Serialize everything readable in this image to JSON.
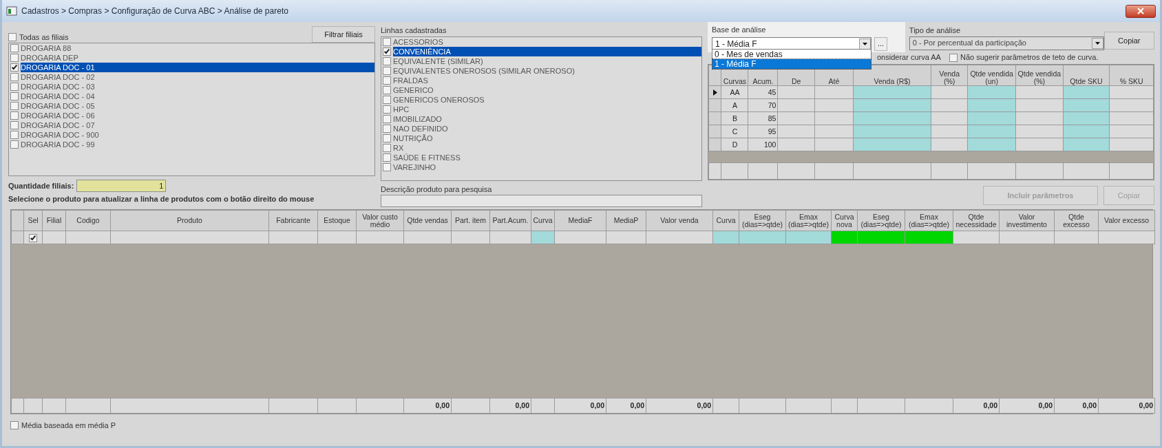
{
  "window": {
    "title": "Cadastros > Compras > Configuração de Curva ABC > Análise de pareto"
  },
  "branches": {
    "all": {
      "label": "Todas as filiais",
      "checked": false
    },
    "filter_button": "Filtrar filiais",
    "items": [
      {
        "label": "DROGARIA 88",
        "checked": false,
        "selected": false
      },
      {
        "label": "DROGARIA DEP",
        "checked": false,
        "selected": false
      },
      {
        "label": "DROGARIA DOC - 01",
        "checked": true,
        "selected": true
      },
      {
        "label": "DROGARIA DOC - 02",
        "checked": false,
        "selected": false
      },
      {
        "label": "DROGARIA DOC - 03",
        "checked": false,
        "selected": false
      },
      {
        "label": "DROGARIA DOC - 04",
        "checked": false,
        "selected": false
      },
      {
        "label": "DROGARIA DOC - 05",
        "checked": false,
        "selected": false
      },
      {
        "label": "DROGARIA DOC - 06",
        "checked": false,
        "selected": false
      },
      {
        "label": "DROGARIA DOC - 07",
        "checked": false,
        "selected": false
      },
      {
        "label": "DROGARIA DOC - 900",
        "checked": false,
        "selected": false
      },
      {
        "label": "DROGARIA DOC - 99",
        "checked": false,
        "selected": false
      }
    ]
  },
  "branch_count": {
    "label": "Quantidade filiais:",
    "value": "1"
  },
  "instruction": "Selecione o produto para atualizar a linha de produtos com o botão direito do mouse",
  "product_lines": {
    "label": "Linhas cadastradas",
    "items": [
      {
        "label": "ACESSORIOS",
        "checked": false,
        "selected": false
      },
      {
        "label": "CONVENIÊNCIA",
        "checked": true,
        "selected": true
      },
      {
        "label": "EQUIVALENTE (SIMILAR)",
        "checked": false,
        "selected": false
      },
      {
        "label": "EQUIVALENTES ONEROSOS (SIMILAR ONEROSO)",
        "checked": false,
        "selected": false
      },
      {
        "label": "FRALDAS",
        "checked": false,
        "selected": false
      },
      {
        "label": "GENERICO",
        "checked": false,
        "selected": false
      },
      {
        "label": "GENERICOS ONEROSOS",
        "checked": false,
        "selected": false
      },
      {
        "label": "HPC",
        "checked": false,
        "selected": false
      },
      {
        "label": "IMOBILIZADO",
        "checked": false,
        "selected": false
      },
      {
        "label": "NAO DEFINIDO",
        "checked": false,
        "selected": false
      },
      {
        "label": "NUTRIÇÃO",
        "checked": false,
        "selected": false
      },
      {
        "label": "RX",
        "checked": false,
        "selected": false
      },
      {
        "label": "SAÚDE E FITNESS",
        "checked": false,
        "selected": false
      },
      {
        "label": "VAREJINHO",
        "checked": false,
        "selected": false
      }
    ]
  },
  "search": {
    "label": "Descrição produto para pesquisa"
  },
  "analysis_base": {
    "label": "Base de análise",
    "value": "1 - Média F",
    "more_button": "...",
    "options": [
      {
        "label": "0 - Mes de vendas",
        "selected": false
      },
      {
        "label": "1 - Média F",
        "selected": true
      }
    ]
  },
  "analysis_type": {
    "label": "Tipo de análise",
    "value": "0 - Por percentual da participação"
  },
  "copy_button": "Copiar",
  "consider_aa_label": "onsiderar curva AA",
  "no_ceiling": {
    "label": "Não sugerir parâmetros de teto de curva.",
    "checked": false
  },
  "curves": {
    "columns": [
      {
        "label": "Curvas"
      },
      {
        "label": "Acum."
      },
      {
        "label": "De"
      },
      {
        "label": "Até"
      },
      {
        "label": "Venda (R$)",
        "color": "#a3dada"
      },
      {
        "label": "Venda (%)"
      },
      {
        "label": "Qtde vendida (un)",
        "color": "#a3dada"
      },
      {
        "label": "Qtde vendida (%)"
      },
      {
        "label": "Qtde SKU",
        "color": "#a3dada"
      },
      {
        "label": "% SKU"
      }
    ],
    "rows": [
      {
        "curve": "AA",
        "accum": "45",
        "current": true
      },
      {
        "curve": "A",
        "accum": "70",
        "current": false
      },
      {
        "curve": "B",
        "accum": "85",
        "current": false
      },
      {
        "curve": "C",
        "accum": "95",
        "current": false
      },
      {
        "curve": "D",
        "accum": "100",
        "current": false
      }
    ]
  },
  "include_button": {
    "label": "Incluir parâmetros",
    "disabled": true
  },
  "copy_button_2": {
    "label": "Copiar",
    "disabled": true
  },
  "products": {
    "columns": [
      {
        "label": "Sel"
      },
      {
        "label": "Filial"
      },
      {
        "label": "Codigo"
      },
      {
        "label": "Produto"
      },
      {
        "label": "Fabricante"
      },
      {
        "label": "Estoque"
      },
      {
        "label": "Valor custo médio"
      },
      {
        "label": "Qtde vendas",
        "total": "0,00"
      },
      {
        "label": "Part. item"
      },
      {
        "label": "Part.Acum.",
        "total": "0,00"
      },
      {
        "label": "Curva",
        "color": "#a3dada"
      },
      {
        "label": "MediaF",
        "total": "0,00"
      },
      {
        "label": "MediaP",
        "total": "0,00"
      },
      {
        "label": "Valor venda",
        "total": "0,00"
      },
      {
        "label": "Curva",
        "color": "#a3dada"
      },
      {
        "label": "Eseg (dias=>qtde)",
        "color": "#a3dada"
      },
      {
        "label": "Emax (dias=>qtde)",
        "color": "#a3dada"
      },
      {
        "label": "Curva nova",
        "color": "#00d600"
      },
      {
        "label": "Eseg (dias=>qtde)",
        "color": "#00d600"
      },
      {
        "label": "Emax (dias=>qtde)",
        "color": "#00d600"
      },
      {
        "label": "Qtde necessidade",
        "total": "0,00"
      },
      {
        "label": "Valor investimento",
        "total": "0,00"
      },
      {
        "label": "Qtde excesso",
        "total": "0,00"
      },
      {
        "label": "Valor excesso",
        "total": "0,00"
      }
    ],
    "rows": [
      {
        "checked": true
      }
    ]
  },
  "average_p": {
    "label": "Média baseada em média P",
    "checked": false
  }
}
